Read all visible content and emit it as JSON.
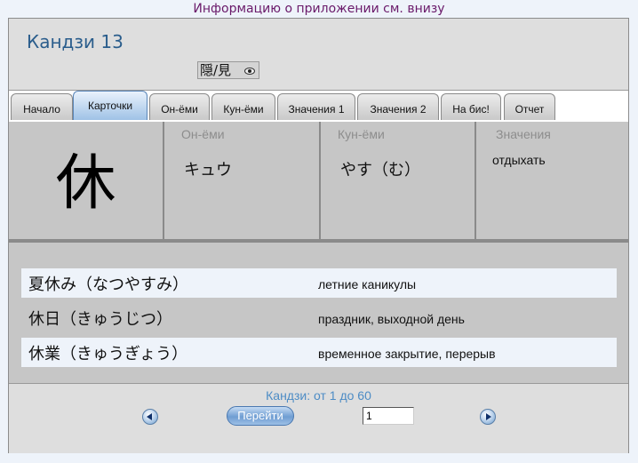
{
  "top_note": "Информацию о приложении см. внизу",
  "header": {
    "title": "Кандзи 13",
    "toggle_label": "隠/見"
  },
  "tabs": [
    {
      "label": "Начало"
    },
    {
      "label": "Карточки"
    },
    {
      "label": "Он-ёми"
    },
    {
      "label": "Кун-ёми"
    },
    {
      "label": "Значения 1"
    },
    {
      "label": "Значения 2"
    },
    {
      "label": "На бис!"
    },
    {
      "label": "Отчет"
    }
  ],
  "active_tab": "Карточки",
  "card": {
    "kanji": "休",
    "on_label": "Он-ёми",
    "on_value": "キュウ",
    "kun_label": "Кун-ёми",
    "kun_value": "やす（む）",
    "meaning_label": "Значения",
    "meaning_value": "отдыхать"
  },
  "examples": [
    {
      "word": "夏休み（なつやすみ）",
      "translation": "летние каникулы"
    },
    {
      "word": "休日（きゅうじつ）",
      "translation": "праздник, выходной день"
    },
    {
      "word": "休業（きゅうぎょう）",
      "translation": "временное закрытие, перерыв"
    }
  ],
  "footer": {
    "range_text": "Кандзи: от 1 до 60",
    "go_label": "Перейти",
    "page_value": "1"
  },
  "icons": {
    "toggle": "eye-icon",
    "prev": "prev-arrow-icon",
    "next": "next-arrow-icon"
  },
  "colors": {
    "title": "#2a5d8c",
    "top_note": "#6a1a6a",
    "range": "#4d8cc5",
    "active_tab": "#9fc2e6"
  }
}
